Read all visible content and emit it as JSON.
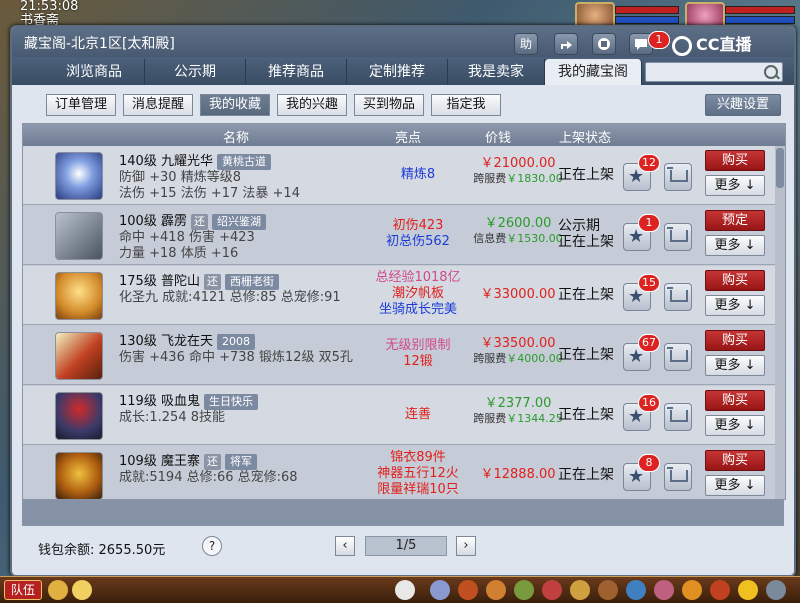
{
  "hud": {
    "time": "21:53:08",
    "location": "书香斋"
  },
  "window": {
    "title": "藏宝阁-北京1区[太和殿]",
    "buttons": [
      "助"
    ],
    "message_badge": "1",
    "brand": "CC直播"
  },
  "tabs": [
    "浏览商品",
    "公示期",
    "推荐商品",
    "定制推荐",
    "我是卖家",
    "我的藏宝阁"
  ],
  "active_tab": "我的藏宝阁",
  "subtabs": [
    "订单管理",
    "消息提醒",
    "我的收藏",
    "我的兴趣",
    "买到物品",
    "指定我"
  ],
  "active_subtab": "我的收藏",
  "interest_settings": "兴趣设置",
  "table": {
    "headers": {
      "name": "名称",
      "highlight": "亮点",
      "price": "价钱",
      "status": "上架状态"
    },
    "rows": [
      {
        "line1": "140级  九耀光华",
        "tag": "黄桃古道",
        "huan": "",
        "line2": "防御 +30  精炼等级8",
        "line3": "法伤 +15  法伤 +17  法暴 +14",
        "highlights": [
          {
            "text": "精炼8",
            "color": "blue"
          }
        ],
        "price": "￥21000.00",
        "price_green": false,
        "fee_label": "跨服费",
        "fee": "￥1830.00",
        "status": [
          "正在上架"
        ],
        "stars": "12",
        "buy": "购买",
        "more": "更多"
      },
      {
        "line1": "100级  霹雳",
        "tag": "绍兴鉴湖",
        "huan": "还",
        "line2": "命中 +418  伤害 +423",
        "line3": "力量 +18  体质 +16",
        "highlights": [
          {
            "text": "初伤423",
            "color": "red"
          },
          {
            "text": "初总伤562",
            "color": "blue"
          }
        ],
        "price": "￥2600.00",
        "price_green": true,
        "fee_label": "信息费",
        "fee": "￥1530.00",
        "status": [
          "公示期",
          "正在上架"
        ],
        "stars": "1",
        "buy": "预定",
        "more": "更多"
      },
      {
        "line1": "175级  普陀山",
        "tag": "西栅老街",
        "huan": "还",
        "line2": "化圣九  成就:4121  总修:85  总宠修:91",
        "line3": "",
        "highlights": [
          {
            "text": "总经验1018亿",
            "color": "pink"
          },
          {
            "text": "潮汐帆板",
            "color": "red"
          },
          {
            "text": "坐骑成长完美",
            "color": "blue"
          }
        ],
        "price": "￥33000.00",
        "price_green": false,
        "fee_label": "",
        "fee": "",
        "status": [
          "正在上架"
        ],
        "stars": "15",
        "buy": "购买",
        "more": "更多"
      },
      {
        "line1": "130级  飞龙在天",
        "tag": "2008",
        "huan": "",
        "line2": "伤害 +436  命中 +738  锻炼12级  双5孔",
        "line3": "",
        "highlights": [
          {
            "text": "无级别限制",
            "color": "pink"
          },
          {
            "text": "12锻",
            "color": "red"
          }
        ],
        "price": "￥33500.00",
        "price_green": false,
        "fee_label": "跨服费",
        "fee": "￥4000.00",
        "status": [
          "正在上架"
        ],
        "stars": "67",
        "buy": "购买",
        "more": "更多"
      },
      {
        "line1": "119级  吸血鬼",
        "tag": "生日快乐",
        "huan": "",
        "line2": "成长:1.254  8技能",
        "line3": "",
        "highlights": [
          {
            "text": "连善",
            "color": "red"
          }
        ],
        "price": "￥2377.00",
        "price_green": true,
        "fee_label": "跨服费",
        "fee": "￥1344.25",
        "status": [
          "正在上架"
        ],
        "stars": "16",
        "buy": "购买",
        "more": "更多"
      },
      {
        "line1": "109级  魔王寨",
        "tag": "将军",
        "huan": "还",
        "line2": "成就:5194  总修:66  总宠修:68",
        "line3": "",
        "highlights": [
          {
            "text": "锦衣89件",
            "color": "red"
          },
          {
            "text": "神器五行12火",
            "color": "red"
          },
          {
            "text": "限量祥瑞10只",
            "color": "red"
          }
        ],
        "price": "￥12888.00",
        "price_green": false,
        "fee_label": "",
        "fee": "",
        "status": [
          "正在上架"
        ],
        "stars": "8",
        "buy": "购买",
        "more": "更多"
      }
    ]
  },
  "footer": {
    "wallet": "钱包余额: 2655.50元",
    "page": "1/5"
  },
  "bottombar": {
    "team": "队伍"
  }
}
